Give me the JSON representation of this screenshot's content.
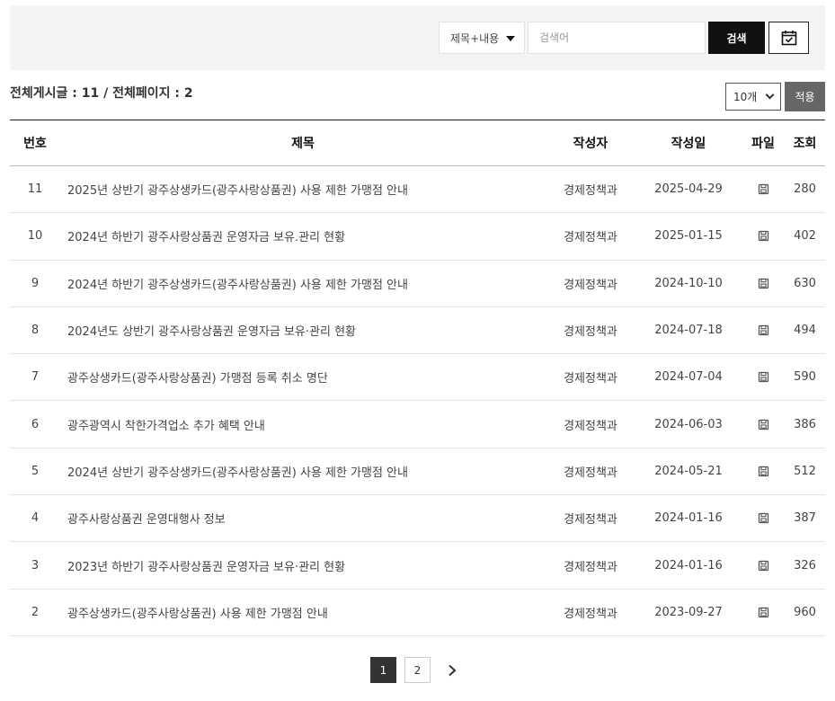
{
  "search": {
    "field_selected": "제목+내용",
    "placeholder": "검색어",
    "button_label": "검색",
    "calendar_icon": "calendar-check-icon"
  },
  "summary": {
    "text": "전체게시글 : 11 / 전체페이지 : 2"
  },
  "page_size": {
    "selected": "10개",
    "apply_label": "적용"
  },
  "table": {
    "headers": {
      "no": "번호",
      "title": "제목",
      "author": "작성자",
      "date": "작성일",
      "file": "파일",
      "views": "조회"
    },
    "rows": [
      {
        "no": "11",
        "title": "2025년 상반기 광주상생카드(광주사랑상품권) 사용 제한 가맹점 안내",
        "author": "경제정책과",
        "date": "2025-04-29",
        "views": "280"
      },
      {
        "no": "10",
        "title": "2024년 하반기 광주사랑상품권 운영자금 보유.관리 현황",
        "author": "경제정책과",
        "date": "2025-01-15",
        "views": "402"
      },
      {
        "no": "9",
        "title": "2024년 하반기 광주상생카드(광주사랑상품권) 사용 제한 가맹점 안내",
        "author": "경제정책과",
        "date": "2024-10-10",
        "views": "630"
      },
      {
        "no": "8",
        "title": "2024년도 상반기 광주사랑상품권 운영자금 보유·관리 현황",
        "author": "경제정책과",
        "date": "2024-07-18",
        "views": "494"
      },
      {
        "no": "7",
        "title": "광주상생카드(광주사랑상품권) 가맹점 등록 취소 명단",
        "author": "경제정책과",
        "date": "2024-07-04",
        "views": "590"
      },
      {
        "no": "6",
        "title": "광주광역시 착한가격업소 추가 혜택 안내",
        "author": "경제정책과",
        "date": "2024-06-03",
        "views": "386"
      },
      {
        "no": "5",
        "title": "2024년 상반기 광주상생카드(광주사랑상품권) 사용 제한 가맹점 안내",
        "author": "경제정책과",
        "date": "2024-05-21",
        "views": "512"
      },
      {
        "no": "4",
        "title": "광주사랑상품권 운영대행사 정보",
        "author": "경제정책과",
        "date": "2024-01-16",
        "views": "387"
      },
      {
        "no": "3",
        "title": "2023년 하반기 광주사랑상품권 운영자금 보유·관리 현황",
        "author": "경제정책과",
        "date": "2024-01-16",
        "views": "326"
      },
      {
        "no": "2",
        "title": "광주상생카드(광주사랑상품권) 사용 제한 가맹점 안내",
        "author": "경제정책과",
        "date": "2023-09-27",
        "views": "960"
      }
    ]
  },
  "pagination": {
    "pages": [
      "1",
      "2"
    ],
    "current": "1"
  }
}
